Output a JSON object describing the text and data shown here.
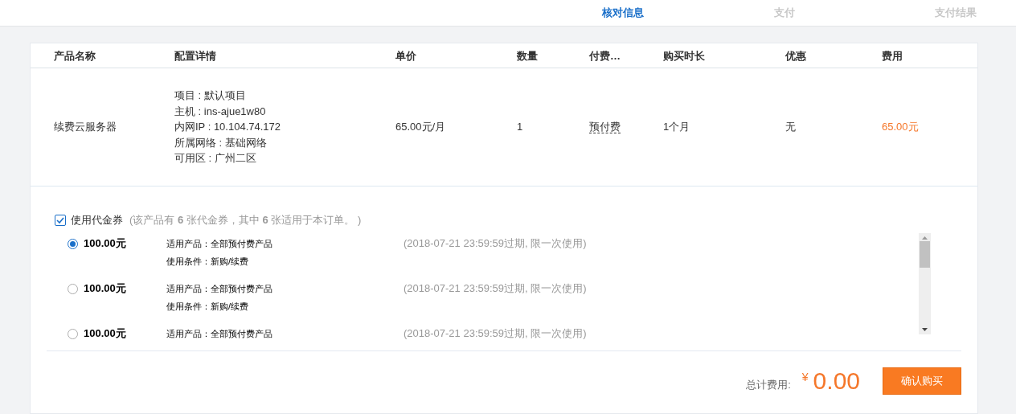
{
  "steps": [
    {
      "label": "核对信息",
      "selected": true
    },
    {
      "label": "支付",
      "selected": false
    },
    {
      "label": "支付结果",
      "selected": false
    }
  ],
  "table": {
    "columns": [
      "产品名称",
      "配置详情",
      "单价",
      "数量",
      "付费…",
      "购买时长",
      "优惠",
      "费用"
    ],
    "rows": [
      {
        "product": "续费云服务器",
        "config": [
          "项目 : 默认项目",
          "主机 : ins-ajue1w80",
          "内网IP : 10.104.74.172",
          "所属网络 : 基础网络",
          "可用区 : 广州二区"
        ],
        "unit_price": "65.00元/月",
        "quantity": "1",
        "billing": "预付费",
        "duration": "1个月",
        "discount": "无",
        "cost": "65.00元"
      }
    ]
  },
  "vouchers": {
    "label": "使用代金券",
    "checked": true,
    "note": "(该产品有 **6** 张代金券，其中 **6** 张适用于本订单。 )",
    "items": [
      {
        "amount": "100.00元",
        "product": "适用产品：全部预付费产品",
        "condition": "使用条件：新购/续费",
        "expiry": "(2018-07-21 23:59:59过期, 限一次使用)",
        "selected": true
      },
      {
        "amount": "100.00元",
        "product": "适用产品：全部预付费产品",
        "condition": "使用条件：新购/续费",
        "expiry": "(2018-07-21 23:59:59过期, 限一次使用)",
        "selected": false
      },
      {
        "amount": "100.00元",
        "product": "适用产品：全部预付费产品",
        "expiry": "(2018-07-21 23:59:59过期, 限一次使用)",
        "selected": false
      }
    ]
  },
  "footer": {
    "total_label": "总计费用:",
    "currency": "¥",
    "total": "0.00",
    "confirm_button": "确认购买"
  }
}
